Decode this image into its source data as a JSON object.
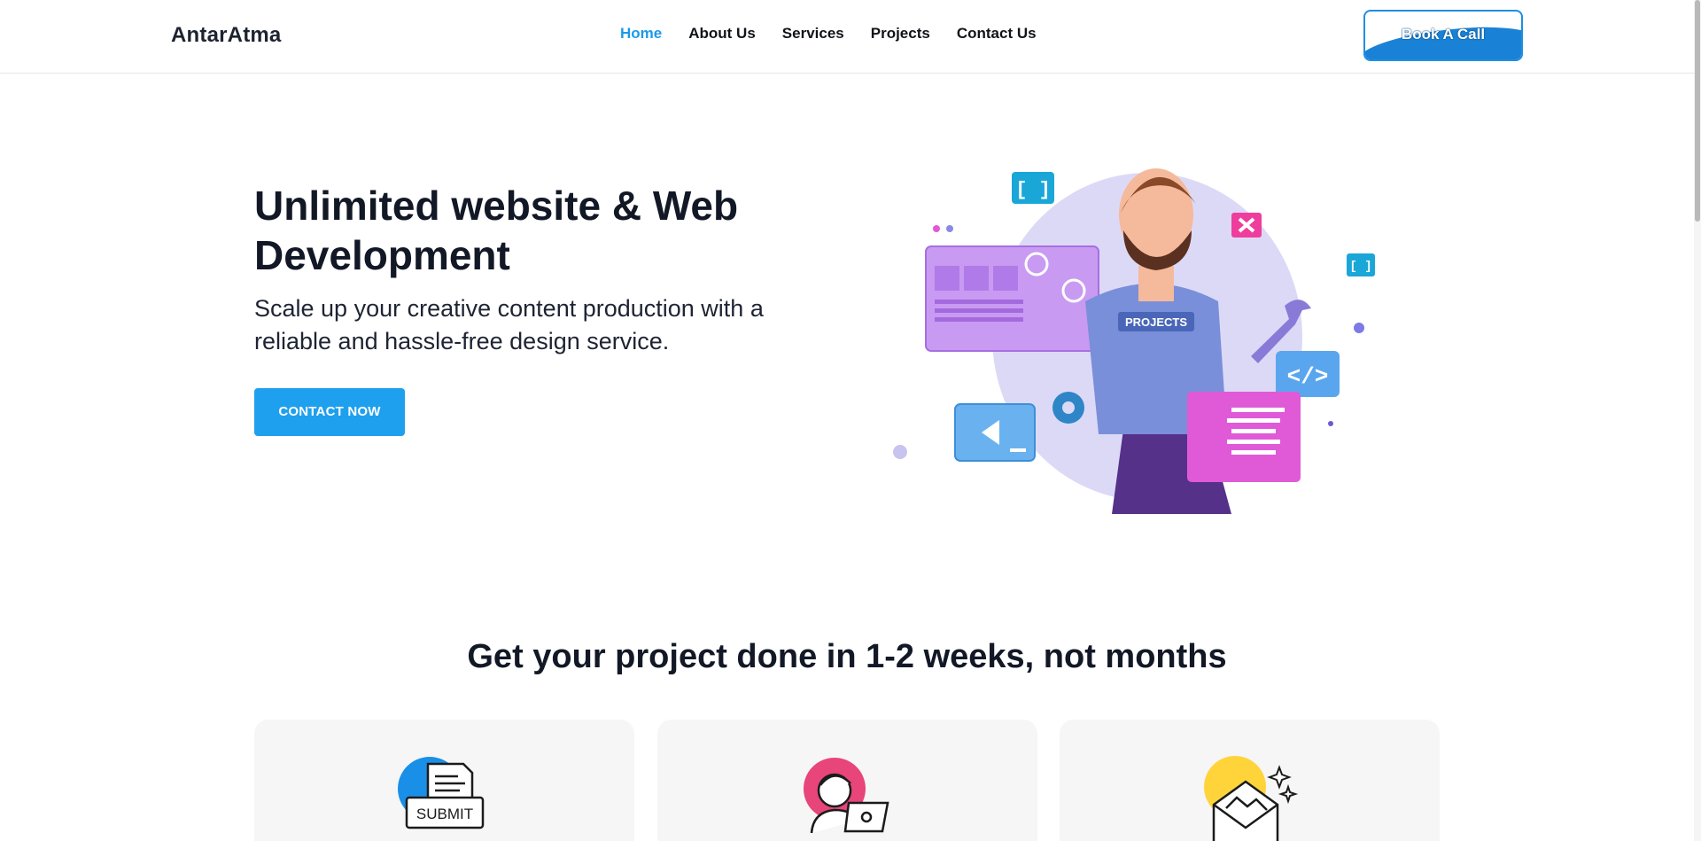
{
  "brand": {
    "name": "AntarAtma",
    "accent": "#1a9ae8"
  },
  "nav": {
    "items": [
      {
        "label": "Home",
        "active": true
      },
      {
        "label": "About Us",
        "active": false
      },
      {
        "label": "Services",
        "active": false
      },
      {
        "label": "Projects",
        "active": false
      },
      {
        "label": "Contact Us",
        "active": false
      }
    ],
    "cta_label": "Book A Call"
  },
  "hero": {
    "title": "Unlimited website & Web Development",
    "subtitle": "Scale up your creative content production with a reliable and hassle-free design service.",
    "button_label": "CONTACT NOW",
    "illustration": {
      "shirt_text": "PROJECTS",
      "icon_names": [
        "bracket-icon",
        "code-icon",
        "play-icon",
        "gear-icon",
        "wrench-icon",
        "close-icon"
      ]
    }
  },
  "process": {
    "title": "Get your project done in 1-2 weeks, not months",
    "cards": [
      {
        "icon": "submit-form-icon",
        "icon_text": "SUBMIT",
        "circle_color": "#1a8fe8"
      },
      {
        "icon": "developer-laptop-icon",
        "circle_color": "#e8457a"
      },
      {
        "icon": "envelope-image-icon",
        "circle_color": "#ffd43b"
      }
    ]
  }
}
